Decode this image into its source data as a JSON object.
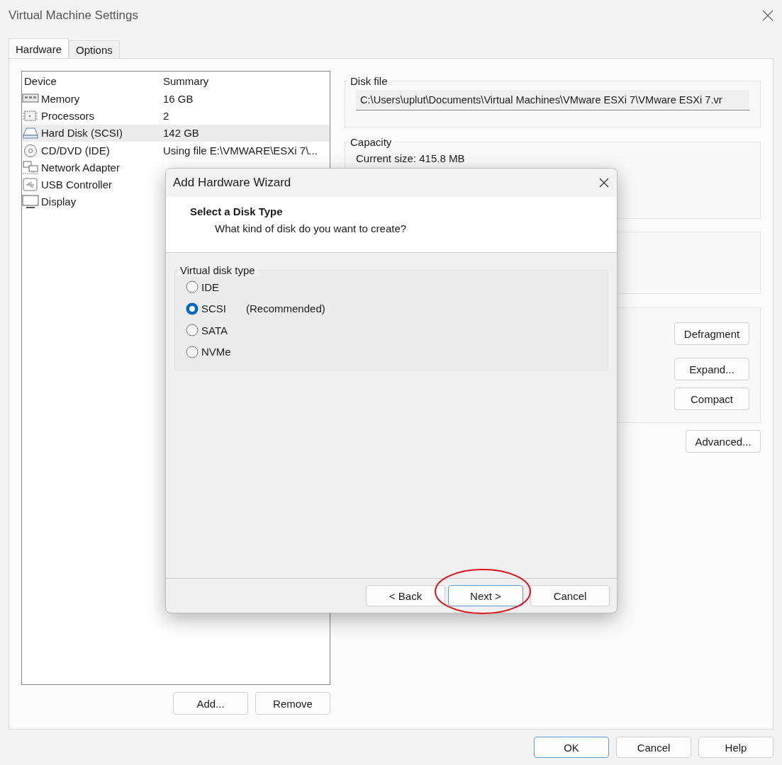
{
  "window": {
    "title": "Virtual Machine Settings"
  },
  "tabs": [
    {
      "label": "Hardware",
      "selected": true
    },
    {
      "label": "Options",
      "selected": false
    }
  ],
  "devices": {
    "columns": [
      "Device",
      "Summary"
    ],
    "rows": [
      {
        "kind": "memory",
        "device": "Memory",
        "summary": "16 GB",
        "selected": false
      },
      {
        "kind": "processor",
        "device": "Processors",
        "summary": "2",
        "selected": false
      },
      {
        "kind": "disk",
        "device": "Hard Disk (SCSI)",
        "summary": "142 GB",
        "selected": true
      },
      {
        "kind": "cd",
        "device": "CD/DVD (IDE)",
        "summary": "Using file E:\\VMWARE\\ESXi 7\\...",
        "selected": false
      },
      {
        "kind": "network",
        "device": "Network Adapter",
        "selected": false
      },
      {
        "kind": "usb",
        "device": "USB Controller",
        "selected": false
      },
      {
        "kind": "display",
        "device": "Display",
        "selected": false
      }
    ]
  },
  "disk_file": {
    "title": "Disk file",
    "value": "C:\\Users\\uplut\\Documents\\Virtual Machines\\VMware ESXi 7\\VMware ESXi 7.vr"
  },
  "capacity": {
    "title": "Capacity",
    "current_size": "Current size: 415.8 MB"
  },
  "utility_buttons": [
    "Defragment",
    "Expand...",
    "Compact"
  ],
  "advanced_button": "Advanced...",
  "list_buttons": [
    "Add...",
    "Remove"
  ],
  "dialog_buttons": [
    {
      "label": "OK",
      "default": true
    },
    {
      "label": "Cancel",
      "default": false
    },
    {
      "label": "Help",
      "default": false
    }
  ],
  "wizard": {
    "title": "Add Hardware Wizard",
    "heading": "Select a Disk Type",
    "subheading": "What kind of disk do you want to create?",
    "group_title": "Virtual disk type",
    "options": [
      {
        "label": "IDE",
        "selected": false
      },
      {
        "label": "SCSI",
        "note": "(Recommended)",
        "selected": true
      },
      {
        "label": "SATA",
        "selected": false
      },
      {
        "label": "NVMe",
        "selected": false
      }
    ],
    "buttons": [
      {
        "label": "< Back",
        "default": false
      },
      {
        "label": "Next >",
        "default": true
      },
      {
        "label": "Cancel",
        "default": false
      }
    ]
  }
}
